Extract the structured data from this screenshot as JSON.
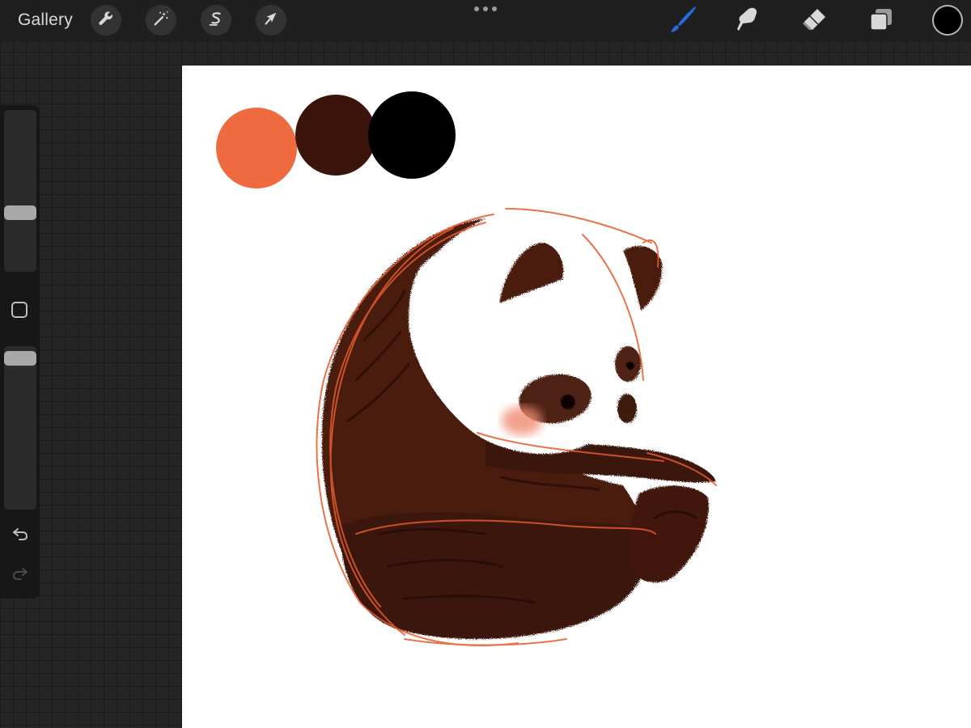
{
  "topbar": {
    "gallery_label": "Gallery",
    "left_tools": [
      {
        "name": "actions",
        "icon": "wrench-icon"
      },
      {
        "name": "adjustments",
        "icon": "magic-wand-icon"
      },
      {
        "name": "selection",
        "icon": "selection-s-icon"
      },
      {
        "name": "transform",
        "icon": "arrow-cursor-icon"
      }
    ],
    "more_icon": "more-dots-icon",
    "right_tools": [
      {
        "name": "brush",
        "icon": "brush-icon",
        "active": true
      },
      {
        "name": "smudge",
        "icon": "smudge-finger-icon",
        "active": false
      },
      {
        "name": "eraser",
        "icon": "eraser-icon",
        "active": false
      },
      {
        "name": "layers",
        "icon": "layers-icon",
        "active": false
      }
    ],
    "current_color": "#000000"
  },
  "sidebar": {
    "brush_size_level": 0.36,
    "opacity_level": 0.05,
    "modify_icon": "square-modify-icon",
    "undo_icon": "undo-arrow-icon",
    "redo_icon": "redo-arrow-icon"
  },
  "canvas": {
    "background": "#ffffff",
    "palette_swatches": [
      "#ef6a3e",
      "#3b140c",
      "#000000"
    ],
    "artwork": "panda-sketch"
  },
  "colors": {
    "accent_active_tool": "#1e6fe6",
    "toolbar_bg": "#1f1f1f",
    "icon_color": "#d8d8d8"
  }
}
